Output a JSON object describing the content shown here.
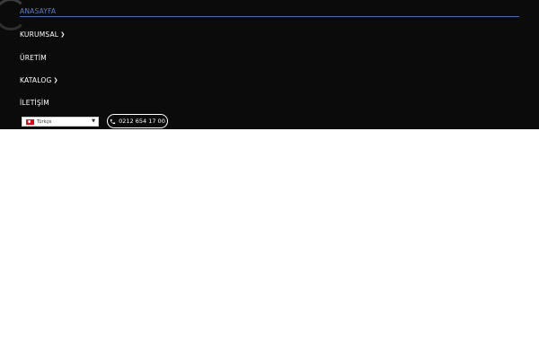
{
  "nav": {
    "items": [
      {
        "label": "ANASAYFA",
        "active": true,
        "dropdown": false
      },
      {
        "label": "KURUMSAL",
        "active": false,
        "dropdown": true
      },
      {
        "label": "ÜRETİM",
        "active": false,
        "dropdown": false
      },
      {
        "label": "KATALOG",
        "active": false,
        "dropdown": true
      },
      {
        "label": "İLETİŞİM",
        "active": false,
        "dropdown": false
      }
    ]
  },
  "language": {
    "selected": "Türkçe",
    "flag_icon": "turkey-flag-icon"
  },
  "contact": {
    "phone": "0212 654 17 00",
    "icon": "phone-icon"
  },
  "colors": {
    "bar_bg": "#0b0b0b",
    "active_link": "#5b7fc7"
  }
}
